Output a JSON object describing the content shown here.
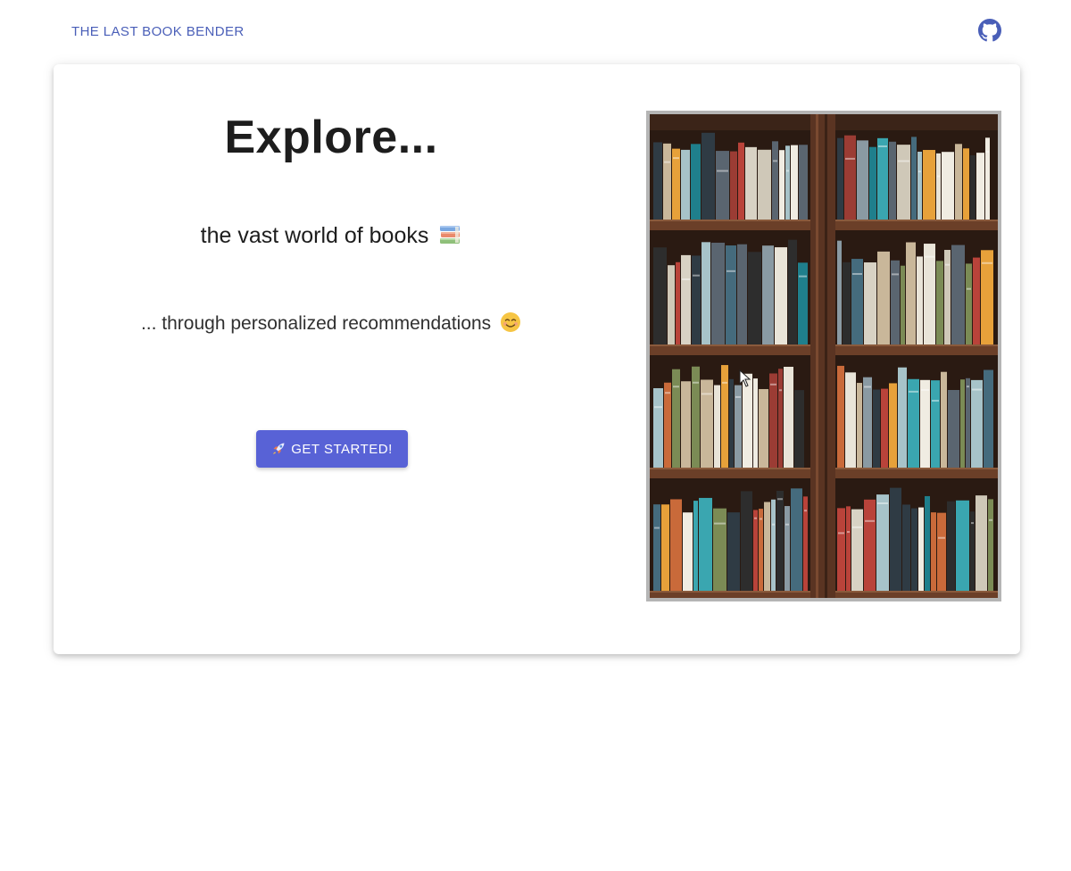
{
  "nav": {
    "brand": "THE LAST BOOK BENDER",
    "github_icon": "github-icon"
  },
  "hero": {
    "title": "Explore...",
    "subtitle": "the vast world of books",
    "subtitle_icon": "books-emoji-icon",
    "description": "... through personalized recommendations",
    "description_icon": "smiling-face-emoji-icon",
    "cta_label": "GET STARTED!",
    "cta_icon": "rocket-icon"
  },
  "image": {
    "alt": "bookshelf photo"
  },
  "colors": {
    "brand": "#4a5fb8",
    "accent": "#5862d6",
    "title": "#1d1d1d"
  }
}
